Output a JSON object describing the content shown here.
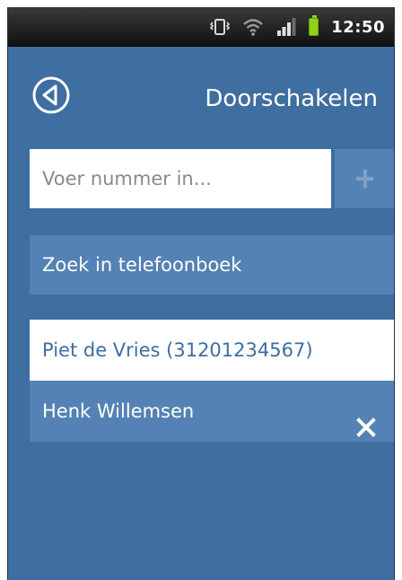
{
  "status_bar": {
    "time": "12:50",
    "icons": [
      "vibrate-icon",
      "wifi-icon",
      "signal-icon",
      "battery-icon"
    ]
  },
  "header": {
    "title": "Doorschakelen",
    "back_icon": "back-arrow-circle-icon"
  },
  "number_input": {
    "placeholder": "Voer nummer in...",
    "value": "",
    "add_icon": "plus-icon"
  },
  "phonebook_button": {
    "label": "Zoek in telefoonboek"
  },
  "contacts": [
    {
      "label": "Piet de Vries (31201234567)",
      "selected": true
    },
    {
      "label": "Henk Willemsen",
      "selected": false,
      "action_icon": "close-icon"
    }
  ],
  "colors": {
    "background": "#3f6ea0",
    "button": "#5482b4",
    "selected_item_bg": "#ffffff",
    "selected_item_text": "#3f6ea0",
    "battery": "#8fd11a"
  }
}
